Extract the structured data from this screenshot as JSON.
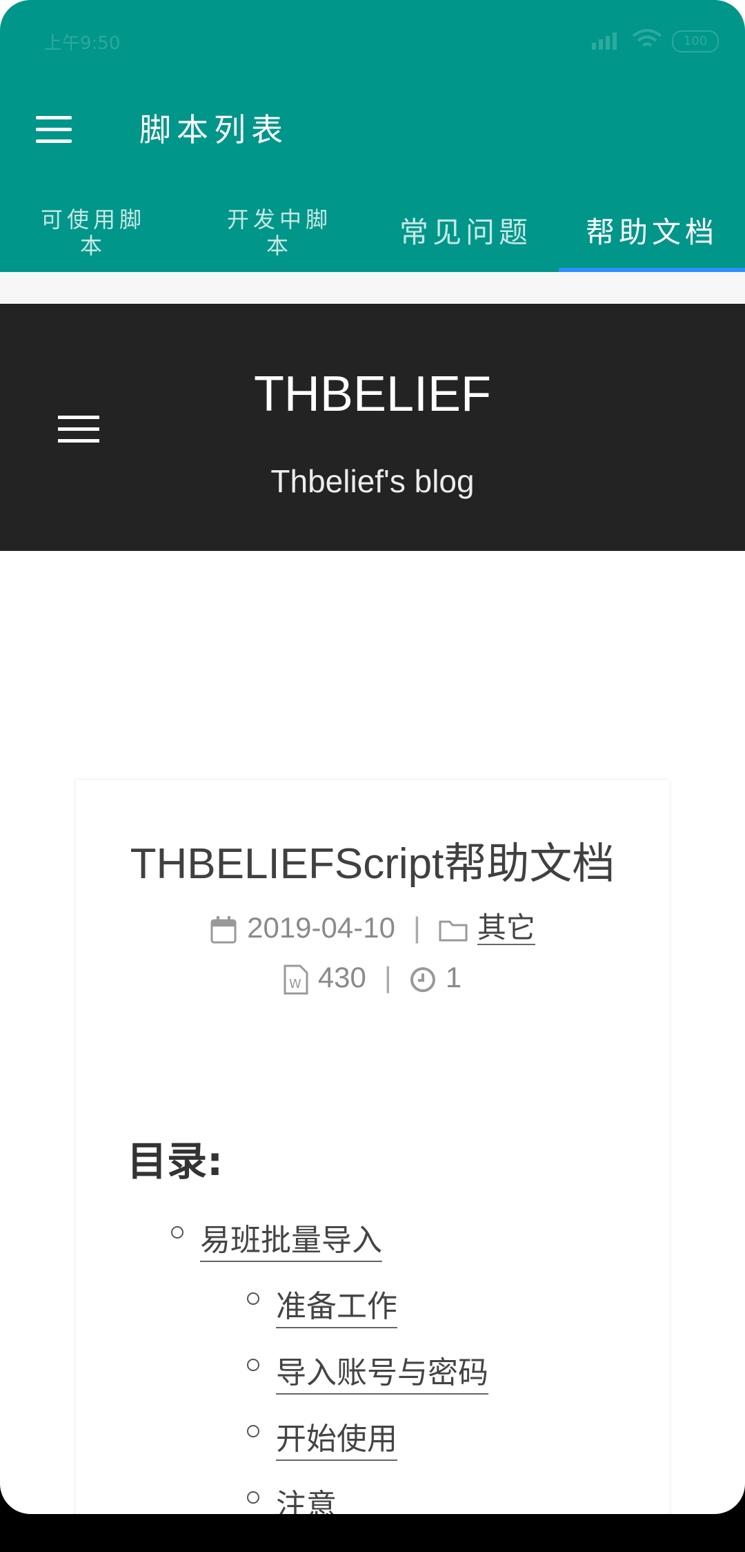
{
  "status_bar": {
    "time": "上午9:50",
    "battery": "100"
  },
  "app_bar": {
    "title": "脚本列表",
    "tabs": [
      {
        "label": "可使用脚本",
        "active": false
      },
      {
        "label": "开发中脚本",
        "active": false
      },
      {
        "label": "常见问题",
        "active": false
      },
      {
        "label": "帮助文档",
        "active": true
      }
    ]
  },
  "banner": {
    "title": "THBELIEF",
    "subtitle": "Thbelief's blog"
  },
  "post": {
    "title": "THBELIEFScript帮助文档",
    "date": "2019-04-10",
    "category": "其它",
    "word_count": "430",
    "read_time": "1",
    "toc_heading": "目录:",
    "toc": [
      {
        "label": "易班批量导入",
        "level": 1
      },
      {
        "label": "准备工作",
        "level": 2
      },
      {
        "label": "导入账号与密码",
        "level": 2
      },
      {
        "label": "开始使用",
        "level": 2
      },
      {
        "label": "注意",
        "level": 2
      }
    ]
  },
  "colors": {
    "app_bar": "#00968a",
    "tab_indicator": "#2e8dff",
    "banner": "#232323"
  }
}
